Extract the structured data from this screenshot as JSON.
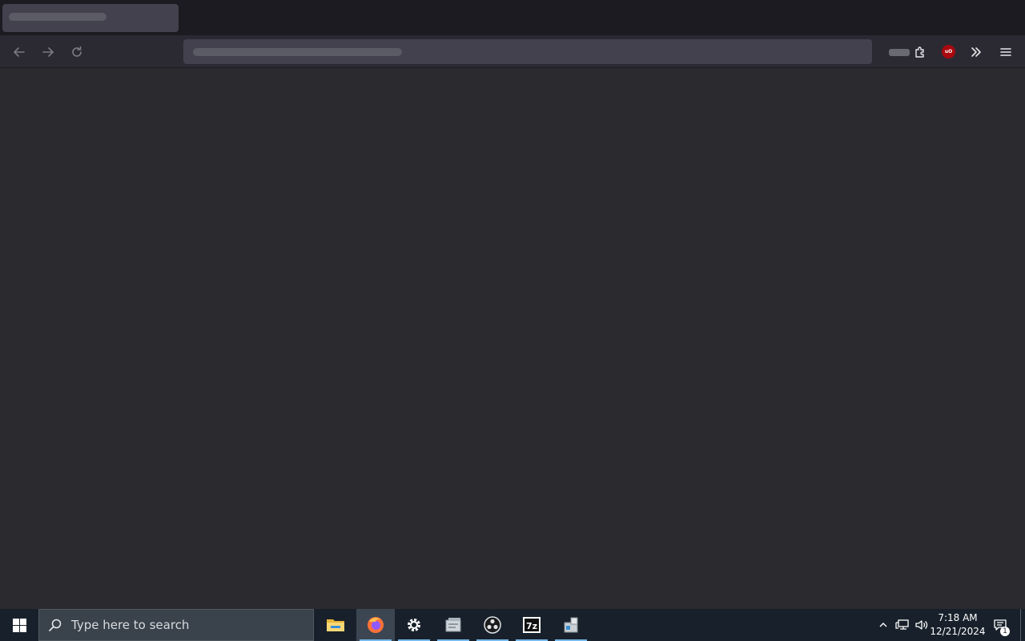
{
  "browser": {
    "tab": {
      "title": ""
    },
    "urlbar": {
      "value": ""
    },
    "toolbar": {
      "back_icon": "arrow-left-icon",
      "forward_icon": "arrow-right-icon",
      "reload_icon": "reload-icon",
      "extension_icon": "puzzle-icon",
      "ublock_badge": "uO",
      "overflow_icon": "double-chevron-right-icon",
      "menu_icon": "hamburger-icon"
    },
    "colors": {
      "tab_bar": "#1c1b21",
      "nav_bar": "#2b2a33",
      "content": "#2a2a2f",
      "url_field": "#42414d"
    }
  },
  "taskbar": {
    "search_placeholder": "Type here to search",
    "apps": [
      {
        "name": "File Explorer",
        "icon": "folder-icon"
      },
      {
        "name": "Firefox",
        "icon": "firefox-icon",
        "active": true
      },
      {
        "name": "Settings",
        "icon": "gear-icon"
      },
      {
        "name": "App",
        "icon": "app-window-icon"
      },
      {
        "name": "OBS",
        "icon": "obs-icon"
      },
      {
        "name": "7-Zip",
        "icon": "7zip-icon",
        "label": "7z"
      },
      {
        "name": "App",
        "icon": "installer-icon"
      }
    ],
    "tray": {
      "clock_time": "7:18 AM",
      "clock_date": "12/21/2024",
      "notification_count": "1"
    },
    "colors": {
      "background": "#18212b",
      "search": "#3a424b",
      "accent": "#76b9ed"
    }
  }
}
